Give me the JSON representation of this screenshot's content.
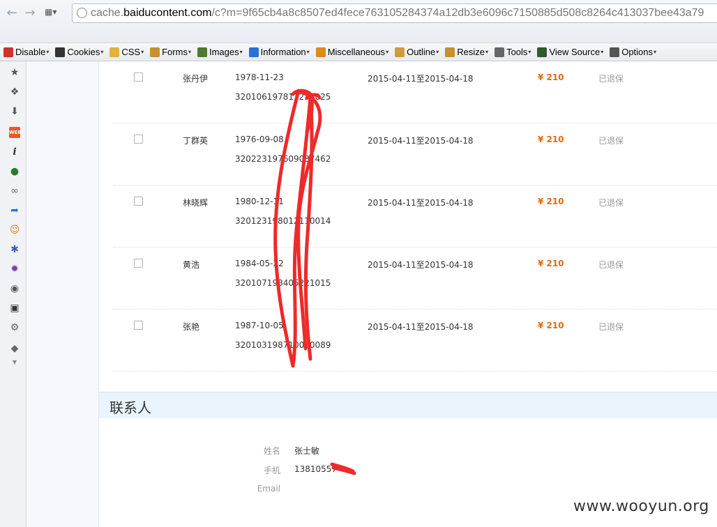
{
  "browser": {
    "url_domain": "cache.baiducontent.com",
    "url_prefix": "cache.",
    "url_domain_core": "baiducontent.com",
    "url_path": "/c?m=9f65cb4a8c8507ed4fece763105284374a12db3e6096c7150885d508c8264c413037bee43a79"
  },
  "webdev_toolbar": {
    "items": [
      {
        "label": "Disable",
        "icon": "disable-icon",
        "color": "#d0312d"
      },
      {
        "label": "Cookies",
        "icon": "cookie-person-icon",
        "color": "#333333"
      },
      {
        "label": "CSS",
        "icon": "css-pencil-icon",
        "color": "#e3b23c"
      },
      {
        "label": "Forms",
        "icon": "forms-icon",
        "color": "#c8902c"
      },
      {
        "label": "Images",
        "icon": "images-icon",
        "color": "#4f7a2c"
      },
      {
        "label": "Information",
        "icon": "information-icon",
        "color": "#2a6fd6"
      },
      {
        "label": "Miscellaneous",
        "icon": "misc-icon",
        "color": "#d98b1f"
      },
      {
        "label": "Outline",
        "icon": "outline-pencil-icon",
        "color": "#d29a3a"
      },
      {
        "label": "Resize",
        "icon": "resize-icon",
        "color": "#c8902c"
      },
      {
        "label": "Tools",
        "icon": "tools-icon",
        "color": "#666666"
      },
      {
        "label": "View Source",
        "icon": "view-source-icon",
        "color": "#2e5a2e"
      },
      {
        "label": "Options",
        "icon": "options-icon",
        "color": "#555555"
      }
    ]
  },
  "insured": {
    "rows": [
      {
        "name": "张丹伊",
        "dob": "1978-11-23",
        "id": "320106197811230025",
        "dates": "2015-04-11至2015-04-18",
        "price": "¥ 210",
        "status": "已退保"
      },
      {
        "name": "丁群英",
        "dob": "1976-09-08",
        "id": "320223197609087462",
        "dates": "2015-04-11至2015-04-18",
        "price": "¥ 210",
        "status": "已退保"
      },
      {
        "name": "林晓辉",
        "dob": "1980-12-11",
        "id": "320123198012110014",
        "dates": "2015-04-11至2015-04-18",
        "price": "¥ 210",
        "status": "已退保"
      },
      {
        "name": "黄浩",
        "dob": "1984-05-22",
        "id": "320107198405221015",
        "dates": "2015-04-11至2015-04-18",
        "price": "¥ 210",
        "status": "已退保"
      },
      {
        "name": "张艳",
        "dob": "1987-10-05",
        "id": "320103198710050089",
        "dates": "2015-04-11至2015-04-18",
        "price": "¥ 210",
        "status": "已退保"
      }
    ]
  },
  "contact": {
    "title": "联系人",
    "name_label": "姓名",
    "name_value": "张士敏",
    "phone_label": "手机",
    "phone_value": "13810557",
    "email_label": "Email",
    "email_value": ""
  },
  "watermark": "www.wooyun.org",
  "colors": {
    "price": "#e56a0e",
    "status": "#999999",
    "redaction": "#ee2a2a",
    "contact_header_bg": "#eaf4fc"
  }
}
